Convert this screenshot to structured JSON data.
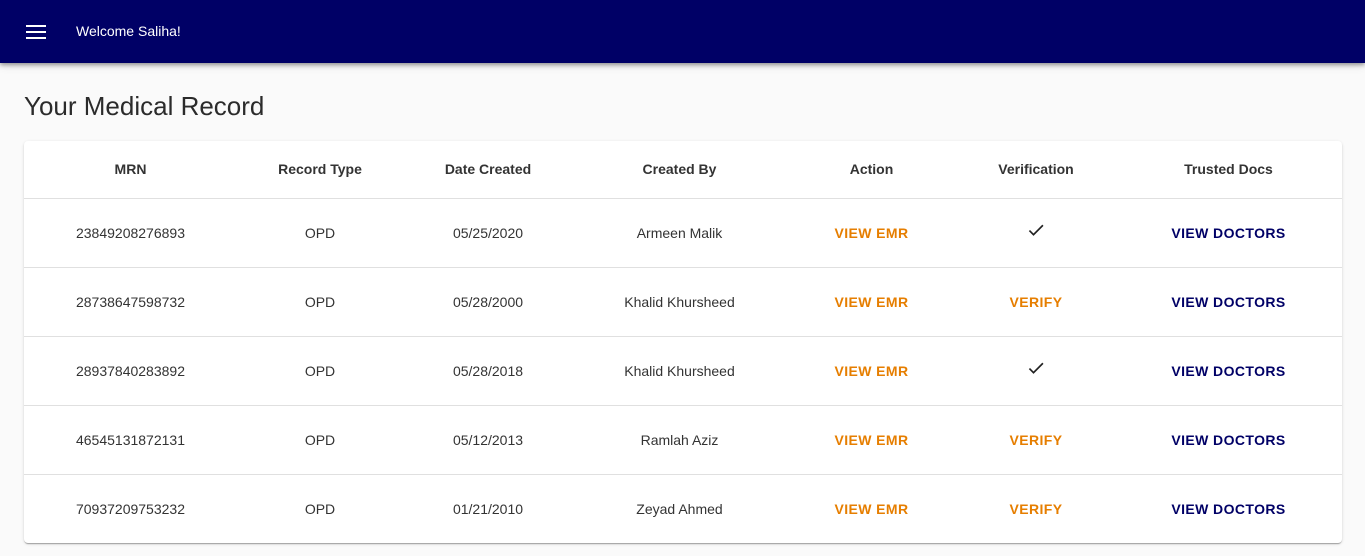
{
  "appbar": {
    "welcome": "Welcome Saliha!",
    "menu_icon": "menu-icon",
    "background": "#000066"
  },
  "page": {
    "title": "Your Medical Record"
  },
  "table": {
    "columns": [
      "MRN",
      "Record Type",
      "Date Created",
      "Created By",
      "Action",
      "Verification",
      "Trusted Docs"
    ],
    "rows": [
      {
        "mrn": "23849208276893",
        "record_type": "OPD",
        "date_created": "05/25/2020",
        "created_by": "Armeen Malik",
        "action": "VIEW EMR",
        "verification": "verified",
        "verify_label": "",
        "trusted_docs": "VIEW DOCTORS"
      },
      {
        "mrn": "28738647598732",
        "record_type": "OPD",
        "date_created": "05/28/2000",
        "created_by": "Khalid Khursheed",
        "action": "VIEW EMR",
        "verification": "unverified",
        "verify_label": "VERIFY",
        "trusted_docs": "VIEW DOCTORS"
      },
      {
        "mrn": "28937840283892",
        "record_type": "OPD",
        "date_created": "05/28/2018",
        "created_by": "Khalid Khursheed",
        "action": "VIEW EMR",
        "verification": "verified",
        "verify_label": "",
        "trusted_docs": "VIEW DOCTORS"
      },
      {
        "mrn": "46545131872131",
        "record_type": "OPD",
        "date_created": "05/12/2013",
        "created_by": "Ramlah Aziz",
        "action": "VIEW EMR",
        "verification": "unverified",
        "verify_label": "VERIFY",
        "trusted_docs": "VIEW DOCTORS"
      },
      {
        "mrn": "70937209753232",
        "record_type": "OPD",
        "date_created": "01/21/2010",
        "created_by": "Zeyad Ahmed",
        "action": "VIEW EMR",
        "verification": "unverified",
        "verify_label": "VERIFY",
        "trusted_docs": "VIEW DOCTORS"
      }
    ]
  },
  "colors": {
    "action": "#e67e00",
    "link": "#000066"
  }
}
